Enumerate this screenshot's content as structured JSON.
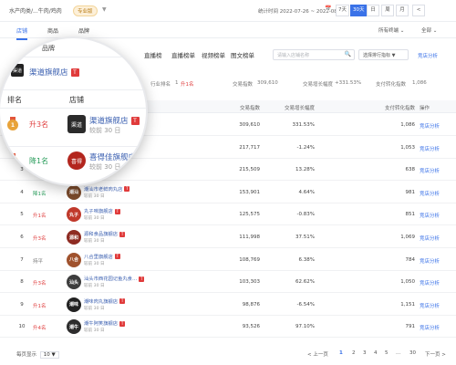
{
  "topbar": {
    "category": "水产肉类/...牛肉/鸡肉",
    "tag": "专业版",
    "chevron_icon": "▼",
    "date_label": "统计时间 2022-07-26 ~ 2022-08-24",
    "calendar_icon": "📅",
    "periods": [
      "7天",
      "30天",
      "日",
      "周",
      "月",
      "<"
    ],
    "active_period_index": 1
  },
  "subtabs": {
    "items": [
      "店铺",
      "商品",
      "品牌"
    ],
    "active_index": 0,
    "filters": [
      "所有终端 ⌄",
      "全部 ⌄"
    ]
  },
  "ranktabs": {
    "items": [
      "高交易",
      "高流量",
      "高意向",
      "直播榜",
      "直播榜单",
      "视频榜单",
      "图文榜单"
    ],
    "search_placeholder": "请输入店铺名称",
    "search_icon": "🔍",
    "sort_label": "选择排行指标 ▼",
    "help_link": "竞店分析"
  },
  "summary": {
    "rank_label": "行业排名",
    "rank_value": "1",
    "rank_change": "升1名",
    "index_label": "交易指数",
    "index_value": "309,610",
    "growth_label": "交易增长幅度",
    "growth_value": "+331.53%",
    "conv_label": "支付转化指数",
    "conv_value": "1,086"
  },
  "table": {
    "headers": [
      "排名",
      "店铺",
      "交易指数",
      "交易增长幅度",
      "支付转化指数",
      "操作"
    ],
    "rows": [
      {
        "rank": "1",
        "change": "升3名",
        "dir": "up",
        "shop": "渠道旗舰店",
        "sub": "较前 30 日",
        "trade": "309,610",
        "growth": "331.53%",
        "conv": "1,086",
        "op": "竞店分析",
        "logo": "渠道",
        "logo_color": "#2b2b2b"
      },
      {
        "rank": "2",
        "change": "降1名",
        "dir": "down",
        "shop": "喜得佳旗舰店",
        "sub": "较前 30 日",
        "trade": "217,717",
        "growth": "-1.24%",
        "conv": "1,053",
        "op": "竞店分析",
        "logo": "喜得",
        "logo_color": "#b3261e"
      },
      {
        "rank": "3",
        "change": "",
        "dir": "flat",
        "shop": "",
        "sub": "",
        "trade": "215,509",
        "growth": "13.28%",
        "conv": "638",
        "op": "竞店分析",
        "logo": "",
        "logo_color": "#444"
      },
      {
        "rank": "4",
        "change": "降1名",
        "dir": "down",
        "shop": "潮汕市老鲜肉丸店",
        "sub": "较前 30 日",
        "trade": "153,901",
        "growth": "4.64%",
        "conv": "981",
        "op": "竞店分析",
        "logo": "潮汕",
        "logo_color": "#7a4a2b"
      },
      {
        "rank": "5",
        "change": "升1名",
        "dir": "up",
        "shop": "丸子味旗舰店",
        "sub": "较前 30 日",
        "trade": "125,575",
        "growth": "-0.83%",
        "conv": "851",
        "op": "竞店分析",
        "logo": "丸子",
        "logo_color": "#c0392b"
      },
      {
        "rank": "6",
        "change": "升3名",
        "dir": "up",
        "shop": "源和食品旗舰店",
        "sub": "较前 30 日",
        "trade": "111,998",
        "growth": "37.51%",
        "conv": "1,069",
        "op": "竞店分析",
        "logo": "源和",
        "logo_color": "#8e2b22"
      },
      {
        "rank": "7",
        "change": "持平",
        "dir": "flat",
        "shop": "八合里旗舰店",
        "sub": "较前 30 日",
        "trade": "108,769",
        "growth": "6.38%",
        "conv": "784",
        "op": "竞店分析",
        "logo": "八合",
        "logo_color": "#a0522d"
      },
      {
        "rank": "8",
        "change": "升3名",
        "dir": "up",
        "shop": "汕头市西花园记鱼丸食…",
        "sub": "较前 30 日",
        "trade": "103,303",
        "growth": "62.62%",
        "conv": "1,050",
        "op": "竞店分析",
        "logo": "汕头",
        "logo_color": "#3d3d3d"
      },
      {
        "rank": "9",
        "change": "升1名",
        "dir": "up",
        "shop": "潮味肉丸旗舰店",
        "sub": "较前 30 日",
        "trade": "98,876",
        "growth": "-6.54%",
        "conv": "1,151",
        "op": "竞店分析",
        "logo": "潮味",
        "logo_color": "#222"
      },
      {
        "rank": "10",
        "change": "升4名",
        "dir": "up",
        "shop": "潮牛阿笑旗舰店",
        "sub": "较前 30 日",
        "trade": "93,526",
        "growth": "97.10%",
        "conv": "791",
        "op": "竞店分析",
        "logo": "潮牛",
        "logo_color": "#2d2d2d"
      }
    ]
  },
  "lens": {
    "top_shop": "渠道旗舰店",
    "col_rank": "排名",
    "col_shop": "店铺",
    "rows": [
      {
        "change": "升3名",
        "shop": "渠道旗舰店",
        "sub": "较前 30 日"
      },
      {
        "change": "降1名",
        "shop": "喜得佳旗舰店",
        "sub": "较前 30 日"
      }
    ]
  },
  "footer": {
    "page_size_label": "每页显示",
    "page_size": "10 ▼",
    "prev": "< 上一页",
    "pages": [
      "1",
      "2",
      "3",
      "4",
      "5",
      "...",
      "30"
    ],
    "active_page": "1",
    "next": "下一页 >"
  },
  "colors": {
    "accent": "#3a72e8",
    "up": "#e04040",
    "down": "#2a9d5c",
    "medal_gold": "#e8a33a",
    "medal_silver": "#9aa5b1"
  }
}
